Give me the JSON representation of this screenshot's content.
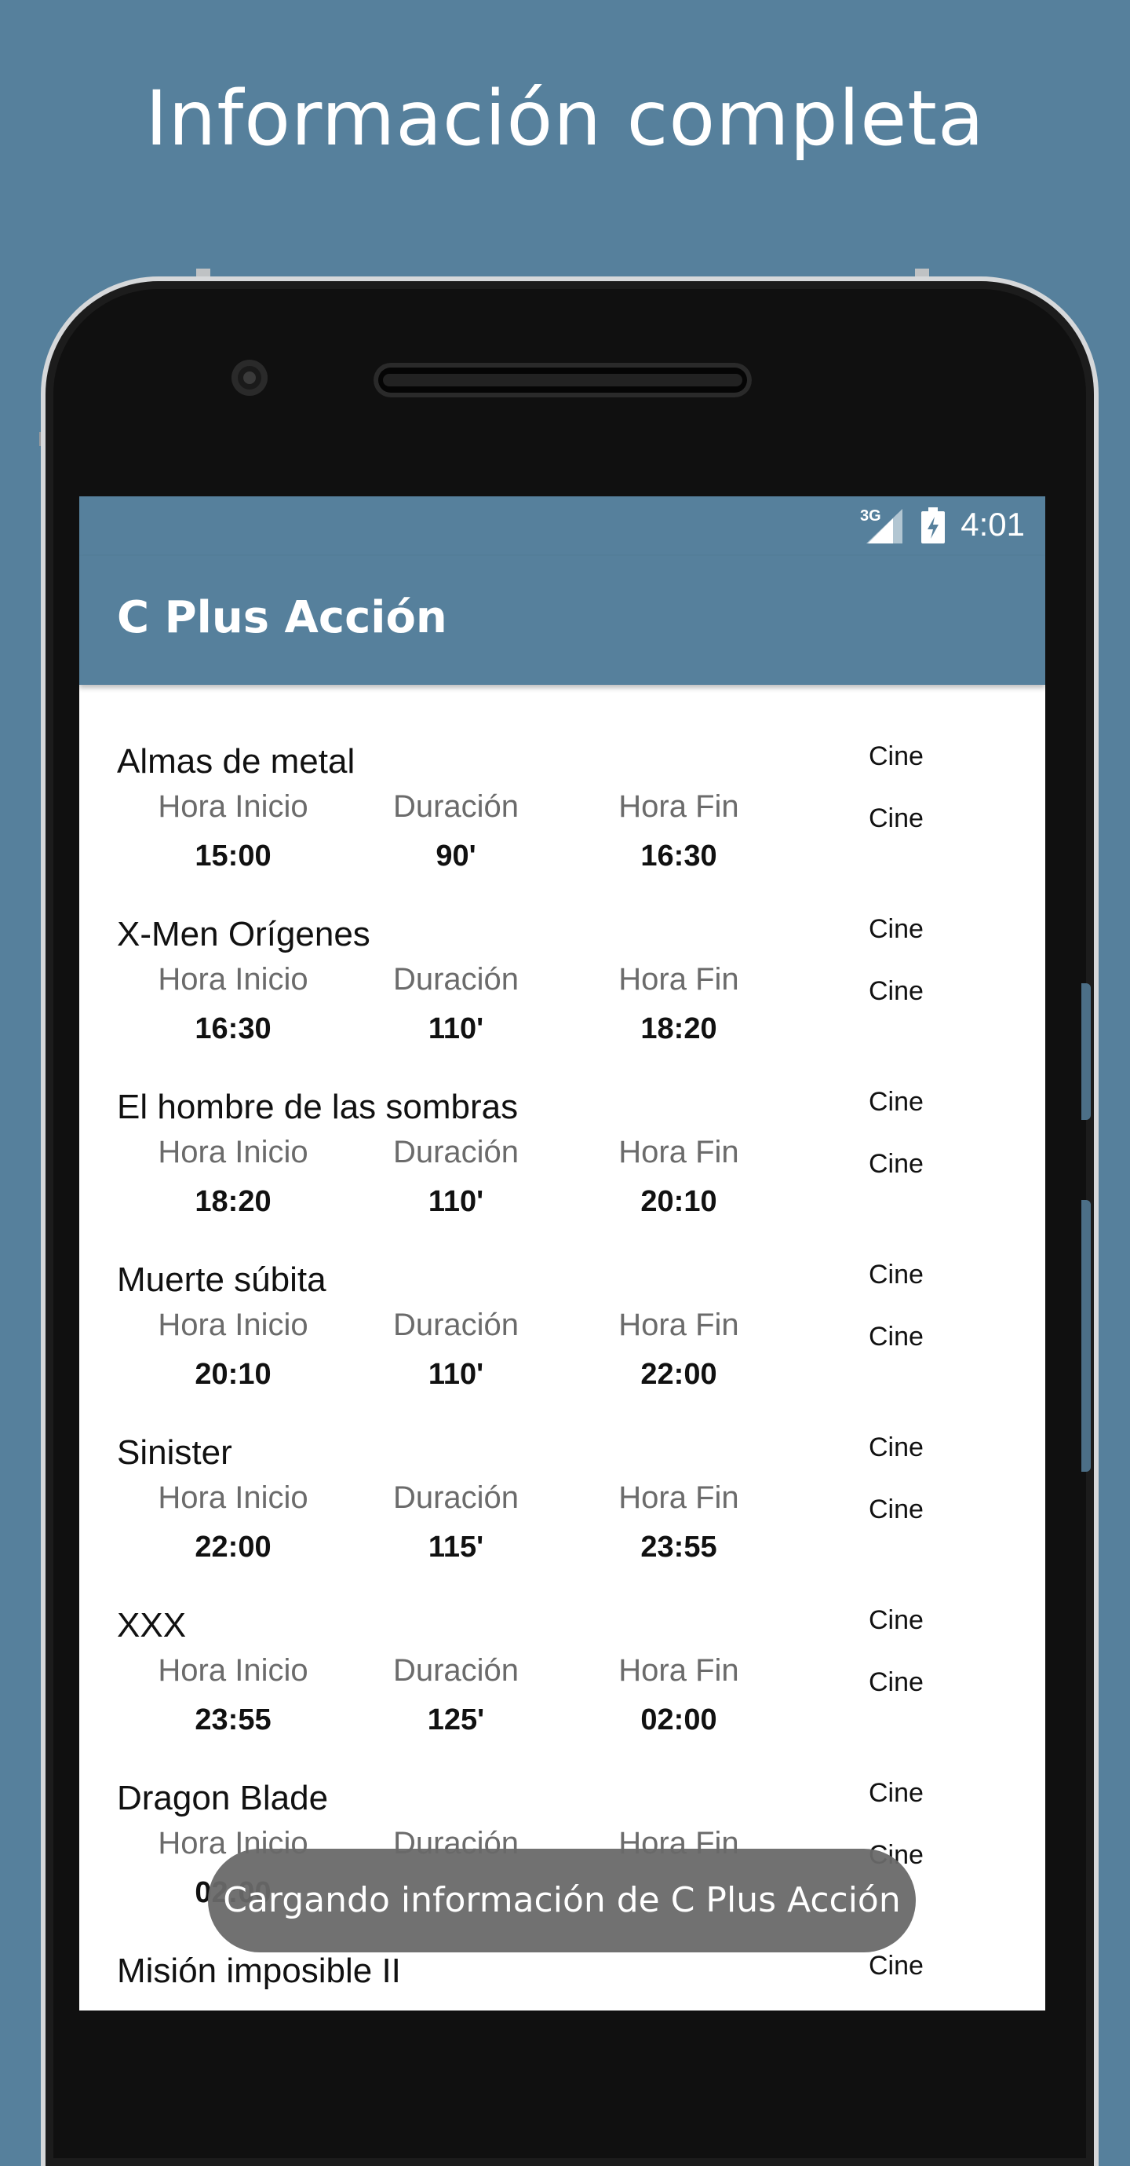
{
  "promo_title": "Información completa",
  "status_bar": {
    "network": "3G",
    "time": "4:01",
    "icons": [
      "signal-icon",
      "battery-charging-icon"
    ]
  },
  "app_bar": {
    "title": "C Plus Acción"
  },
  "column_labels": {
    "start": "Hora Inicio",
    "duration": "Duración",
    "end": "Hora Fin"
  },
  "programs": [
    {
      "name": "Almas de metal",
      "start": "15:00",
      "duration": "90'",
      "end": "16:30",
      "category1": "Cine",
      "category2": "Cine"
    },
    {
      "name": "X-Men Orígenes",
      "start": "16:30",
      "duration": "110'",
      "end": "18:20",
      "category1": "Cine",
      "category2": "Cine"
    },
    {
      "name": "El hombre de las sombras",
      "start": "18:20",
      "duration": "110'",
      "end": "20:10",
      "category1": "Cine",
      "category2": "Cine"
    },
    {
      "name": "Muerte súbita",
      "start": "20:10",
      "duration": "110'",
      "end": "22:00",
      "category1": "Cine",
      "category2": "Cine"
    },
    {
      "name": "Sinister",
      "start": "22:00",
      "duration": "115'",
      "end": "23:55",
      "category1": "Cine",
      "category2": "Cine"
    },
    {
      "name": "XXX",
      "start": "23:55",
      "duration": "125'",
      "end": "02:00",
      "category1": "Cine",
      "category2": "Cine"
    },
    {
      "name": "Dragon Blade",
      "start": "02:00",
      "duration": "",
      "end": "",
      "category1": "Cine",
      "category2": "Cine"
    },
    {
      "name": "Misión imposible II",
      "start": "",
      "duration": "",
      "end": "",
      "category1": "Cine",
      "category2": ""
    }
  ],
  "toast": "Cargando información de C Plus Acción"
}
